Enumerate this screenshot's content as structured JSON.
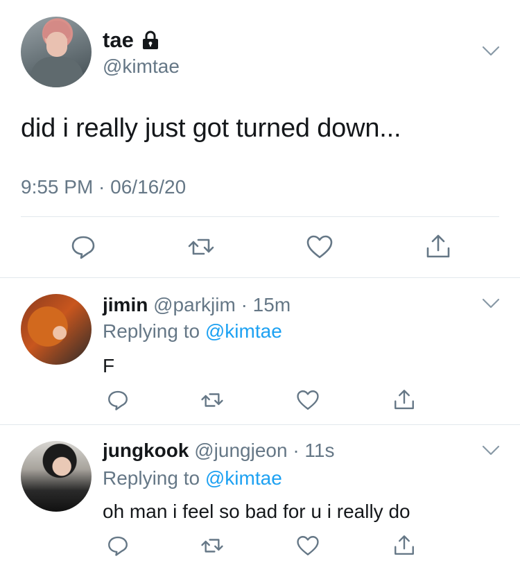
{
  "main_tweet": {
    "name": "tae",
    "handle": "@kimtae",
    "text": "did i really just got turned down...",
    "timestamp": "9:55 PM · 06/16/20",
    "icons": [
      "lock-icon",
      "chevron-down-icon",
      "reply-icon",
      "retweet-icon",
      "like-icon",
      "share-icon"
    ]
  },
  "replies": [
    {
      "name": "jimin",
      "handle": "@parkjim",
      "time": "· 15m",
      "replying_prefix": "Replying to",
      "replying_to": "@kimtae",
      "text": "F"
    },
    {
      "name": "jungkook",
      "handle": "@jungjeon",
      "time": "· 11s",
      "replying_prefix": "Replying to",
      "replying_to": "@kimtae",
      "text": "oh man i feel so bad for u i really do"
    }
  ],
  "colors": {
    "text": "#14171a",
    "secondary": "#657786",
    "link": "#1da1f2",
    "divider": "#e1e8ed"
  }
}
